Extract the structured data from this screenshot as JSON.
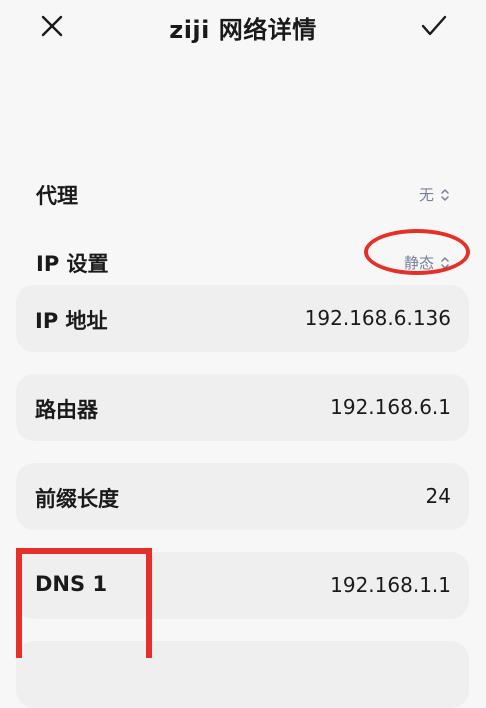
{
  "header": {
    "title": "ziji 网络详情"
  },
  "settings": {
    "proxy": {
      "label": "代理",
      "value": "无"
    },
    "ip_settings": {
      "label": "IP 设置",
      "value": "静态"
    }
  },
  "fields": [
    {
      "label": "IP 地址",
      "value": "192.168.6.136"
    },
    {
      "label": "路由器",
      "value": "192.168.6.1"
    },
    {
      "label": "前缀长度",
      "value": "24"
    },
    {
      "label": "DNS 1",
      "value": "192.168.1.1"
    }
  ],
  "colors": {
    "accent_value": "#7a7f9a",
    "card_background": "#efefef",
    "annotation_red": "#e5302a"
  },
  "icons": {
    "close": "close-icon",
    "confirm": "checkmark-icon",
    "selector": "chevron-updown-icon"
  }
}
